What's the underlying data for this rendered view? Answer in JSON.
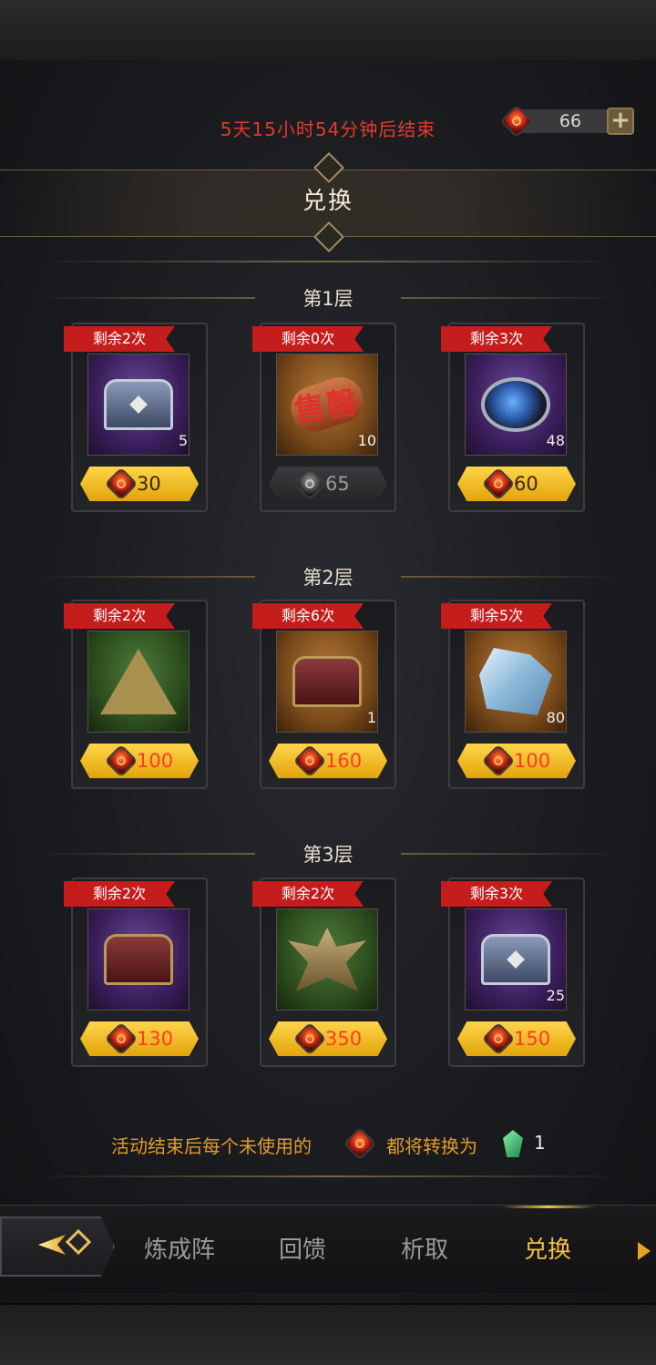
{
  "timer": "5天15小时54分钟后结束",
  "currency": {
    "count": "66",
    "plus": "+"
  },
  "title": "兑换",
  "tiers": [
    {
      "label": "第1层",
      "items": [
        {
          "remaining": "剩余2次",
          "qty": "5",
          "price": "30",
          "art": "silver-chest-icon"
        },
        {
          "remaining": "剩余0次",
          "qty": "10",
          "price": "65",
          "art": "scroll-icon",
          "soldout": "售罄"
        },
        {
          "remaining": "剩余3次",
          "qty": "48",
          "price": "60",
          "art": "blue-orb-icon"
        }
      ]
    },
    {
      "label": "第2层",
      "items": [
        {
          "remaining": "剩余2次",
          "qty": "",
          "price": "100",
          "art": "pyramid-icon"
        },
        {
          "remaining": "剩余6次",
          "qty": "1",
          "price": "160",
          "art": "gold-chest-icon"
        },
        {
          "remaining": "剩余5次",
          "qty": "80",
          "price": "100",
          "art": "ice-crystal-icon"
        }
      ]
    },
    {
      "label": "第3层",
      "items": [
        {
          "remaining": "剩余2次",
          "qty": "",
          "price": "130",
          "art": "gold-chest-icon"
        },
        {
          "remaining": "剩余2次",
          "qty": "",
          "price": "350",
          "art": "spiked-artifact-icon"
        },
        {
          "remaining": "剩余3次",
          "qty": "25",
          "price": "150",
          "art": "silver-chest-icon"
        }
      ]
    }
  ],
  "footer": {
    "text_before": "活动结束后每个未使用的",
    "text_after": "都将转换为",
    "amount": "1"
  },
  "nav": {
    "tabs": [
      "炼成阵",
      "回馈",
      "析取",
      "兑换"
    ],
    "active": "兑换"
  },
  "colors": {
    "accent_gold": "#f0c048",
    "badge_red": "#c51c1c",
    "timer_red": "#e23a2a",
    "note_orange": "#e29a2e"
  }
}
